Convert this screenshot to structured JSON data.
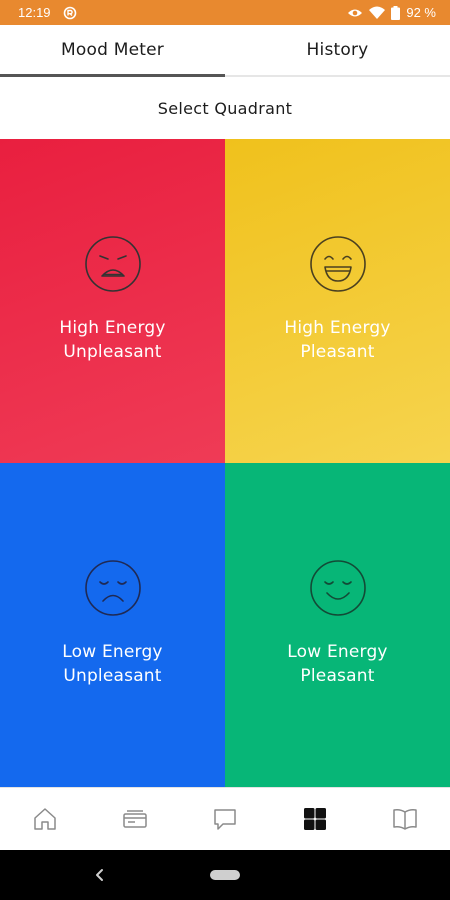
{
  "status_bar": {
    "time": "12:19",
    "battery": "92 %",
    "icons": [
      "app-notification-icon",
      "eye-icon",
      "wifi-icon",
      "battery-icon"
    ]
  },
  "tabs": [
    {
      "label": "Mood Meter",
      "active": true
    },
    {
      "label": "History",
      "active": false
    }
  ],
  "subheader": "Select Quadrant",
  "quadrants": [
    {
      "line1": "High Energy",
      "line2": "Unpleasant",
      "color": "#e91f3f",
      "face": "distressed-face-icon"
    },
    {
      "line1": "High Energy",
      "line2": "Pleasant",
      "color": "#f0c11c",
      "face": "grinning-face-icon"
    },
    {
      "line1": "Low Energy",
      "line2": "Unpleasant",
      "color": "#1469ee",
      "face": "sad-face-icon"
    },
    {
      "line1": "Low Energy",
      "line2": "Pleasant",
      "color": "#07b677",
      "face": "calm-smile-face-icon"
    }
  ],
  "bottom_nav": {
    "items": [
      "home-icon",
      "cards-icon",
      "chat-icon",
      "mood-meter-grid-icon",
      "book-icon"
    ],
    "active_index": 3
  }
}
